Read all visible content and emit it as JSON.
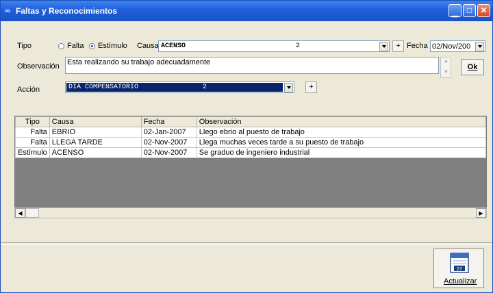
{
  "window": {
    "title": "Faltas y Reconocimientos",
    "title_icon": "glasses-icon",
    "controls": [
      "minimize",
      "maximize",
      "close"
    ]
  },
  "form": {
    "tipo_label": "Tipo",
    "radio_falta": "Falta",
    "radio_estimulo": "Estímulo",
    "selected_tipo": "Estímulo",
    "causa_label": "Causa",
    "causa_value": "ACENSO",
    "causa_code": "2",
    "fecha_label": "Fecha",
    "fecha_value": "02/Nov/200",
    "observacion_label": "Observación",
    "observacion_value": "Esta realizando su trabajo adecuadamente",
    "ok_label": "Ok",
    "accion_label": "Acción",
    "accion_value": "DIA COMPENSATORIO",
    "accion_code": "2",
    "plus": "+"
  },
  "grid": {
    "headers": [
      "Tipo",
      "Causa",
      "Fecha",
      "Observación"
    ],
    "rows": [
      [
        "Falta",
        "EBRIO",
        "02-Jan-2007",
        "Llego ebrio al puesto de trabajo"
      ],
      [
        "Falta",
        "LLEGA TARDE",
        "02-Nov-2007",
        "Llega muchas veces tarde a su puesto de trabajo"
      ],
      [
        "Estímulo",
        "ACENSO",
        "02-Nov-2007",
        "Se graduo de ingeniero industrial"
      ]
    ]
  },
  "actions": {
    "update_label": "Actualizar",
    "update_icon": "calendar-update-icon"
  },
  "colors": {
    "titlebar": "#1f5fd8",
    "window_bg": "#ece9d8",
    "accion_selection": "#0a246a",
    "grid_empty": "#808080"
  }
}
